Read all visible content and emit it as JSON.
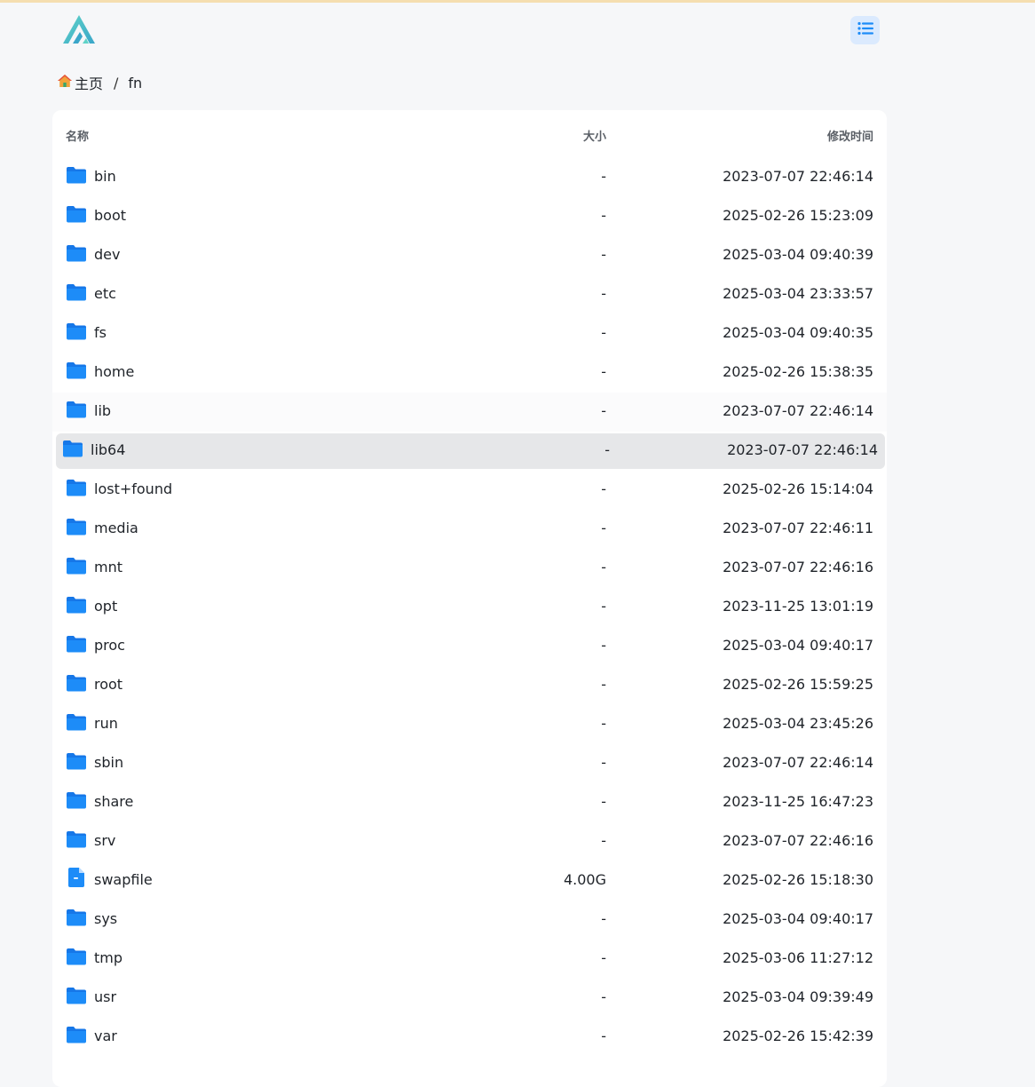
{
  "header": {
    "logo_icon": "app-logo-icon",
    "view_toggle_icon": "list-view-icon",
    "accent_color": "#1d8cf8"
  },
  "breadcrumb": {
    "home_label": "主页",
    "separator": "/",
    "current": "fn"
  },
  "table": {
    "columns": {
      "name": "名称",
      "size": "大小",
      "modified": "修改时间"
    },
    "rows": [
      {
        "name": "bin",
        "type": "folder",
        "size": "-",
        "modified": "2023-07-07 22:46:14"
      },
      {
        "name": "boot",
        "type": "folder",
        "size": "-",
        "modified": "2025-02-26 15:23:09"
      },
      {
        "name": "dev",
        "type": "folder",
        "size": "-",
        "modified": "2025-03-04 09:40:39"
      },
      {
        "name": "etc",
        "type": "folder",
        "size": "-",
        "modified": "2025-03-04 23:33:57"
      },
      {
        "name": "fs",
        "type": "folder",
        "size": "-",
        "modified": "2025-03-04 09:40:35"
      },
      {
        "name": "home",
        "type": "folder",
        "size": "-",
        "modified": "2025-02-26 15:38:35"
      },
      {
        "name": "lib",
        "type": "folder",
        "size": "-",
        "modified": "2023-07-07 22:46:14"
      },
      {
        "name": "lib64",
        "type": "folder",
        "size": "-",
        "modified": "2023-07-07 22:46:14",
        "selected": true
      },
      {
        "name": "lost+found",
        "type": "folder",
        "size": "-",
        "modified": "2025-02-26 15:14:04"
      },
      {
        "name": "media",
        "type": "folder",
        "size": "-",
        "modified": "2023-07-07 22:46:11"
      },
      {
        "name": "mnt",
        "type": "folder",
        "size": "-",
        "modified": "2023-07-07 22:46:16"
      },
      {
        "name": "opt",
        "type": "folder",
        "size": "-",
        "modified": "2023-11-25 13:01:19"
      },
      {
        "name": "proc",
        "type": "folder",
        "size": "-",
        "modified": "2025-03-04 09:40:17"
      },
      {
        "name": "root",
        "type": "folder",
        "size": "-",
        "modified": "2025-02-26 15:59:25"
      },
      {
        "name": "run",
        "type": "folder",
        "size": "-",
        "modified": "2025-03-04 23:45:26"
      },
      {
        "name": "sbin",
        "type": "folder",
        "size": "-",
        "modified": "2023-07-07 22:46:14"
      },
      {
        "name": "share",
        "type": "folder",
        "size": "-",
        "modified": "2023-11-25 16:47:23"
      },
      {
        "name": "srv",
        "type": "folder",
        "size": "-",
        "modified": "2023-07-07 22:46:16"
      },
      {
        "name": "swapfile",
        "type": "file",
        "size": "4.00G",
        "modified": "2025-02-26 15:18:30"
      },
      {
        "name": "sys",
        "type": "folder",
        "size": "-",
        "modified": "2025-03-04 09:40:17"
      },
      {
        "name": "tmp",
        "type": "folder",
        "size": "-",
        "modified": "2025-03-06 11:27:12"
      },
      {
        "name": "usr",
        "type": "folder",
        "size": "-",
        "modified": "2025-03-04 09:39:49"
      },
      {
        "name": "var",
        "type": "folder",
        "size": "-",
        "modified": "2025-02-26 15:42:39"
      }
    ]
  }
}
